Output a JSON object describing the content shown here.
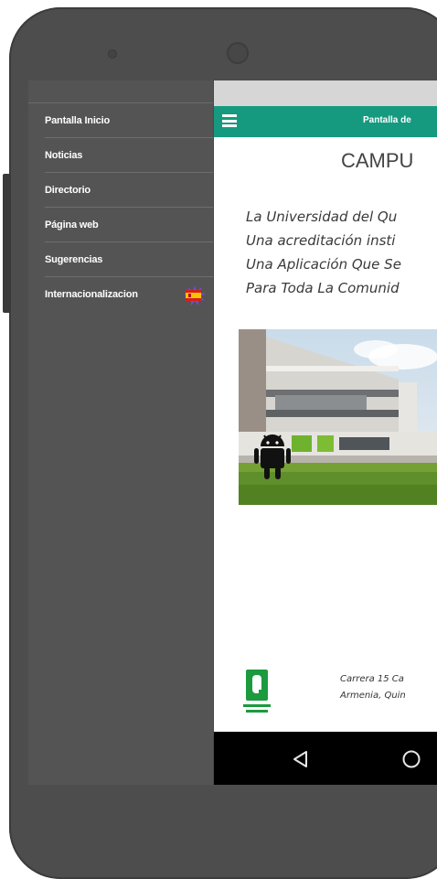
{
  "drawer": {
    "items": [
      {
        "label": "Pantalla Inicio"
      },
      {
        "label": "Noticias"
      },
      {
        "label": "Directorio"
      },
      {
        "label": "Página web"
      },
      {
        "label": "Sugerencias"
      },
      {
        "label": "Internacionalizacion",
        "icon": "spain-flag-icon"
      }
    ]
  },
  "toolbar": {
    "title": "Pantalla de",
    "icon": "hamburger-menu-icon",
    "color": "#159a80"
  },
  "main": {
    "heading": "CAMPU",
    "intro_lines": [
      "La Universidad del Qu",
      "Una acreditación insti",
      "Una Aplicación Que Se",
      "Para Toda La Comunid"
    ],
    "photo": {
      "overlay_icon": "android-robot-icon"
    },
    "logo": {
      "icon": "university-logo-icon"
    },
    "address_lines": [
      "Carrera 15 Ca",
      "Armenia, Quin"
    ]
  },
  "navbar": {
    "icons": [
      "back-triangle-icon",
      "home-circle-icon"
    ]
  }
}
